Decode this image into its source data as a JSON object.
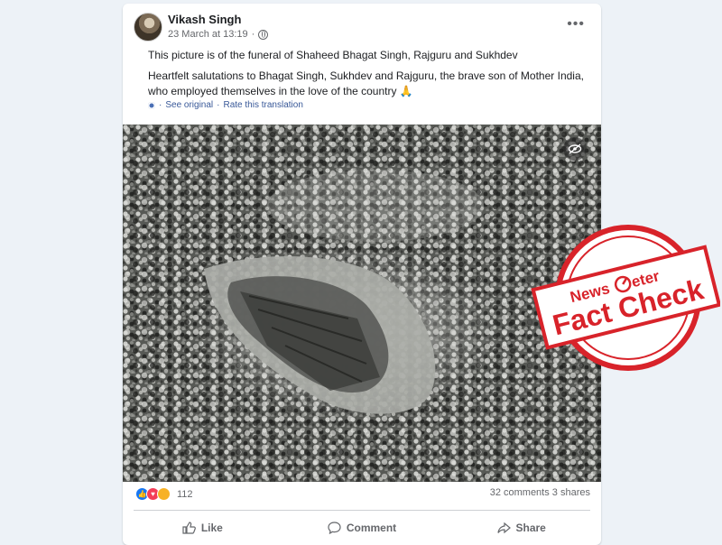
{
  "post": {
    "author": "Vikash Singh",
    "date": "23 March at 13:19",
    "meta_separator": "·",
    "more_label": "•••",
    "text_lines": [
      "This picture is of the funeral of Shaheed Bhagat Singh, Rajguru and Sukhdev",
      "Heartfelt salutations to Bhagat Singh, Sukhdev and Rajguru, the brave son of Mother India, who employed themselves in the love of the country 🙏"
    ],
    "translation": {
      "see_original": "See original",
      "separator": "·",
      "rate": "Rate this translation"
    }
  },
  "stats": {
    "reactions_count": "112",
    "comments": "32 comments",
    "shares": "3 shares"
  },
  "actions": {
    "like": "Like",
    "comment": "Comment",
    "share": "Share"
  },
  "stamp": {
    "brand_left": "News",
    "brand_right": "eter",
    "label": "Fact Check",
    "color": "#d8232a"
  },
  "icons": {
    "privacy": "globe-icon",
    "hide_image": "eye-slash-icon",
    "like": "thumbs-up-icon",
    "comment": "speech-bubble-icon",
    "share": "share-arrow-icon"
  }
}
